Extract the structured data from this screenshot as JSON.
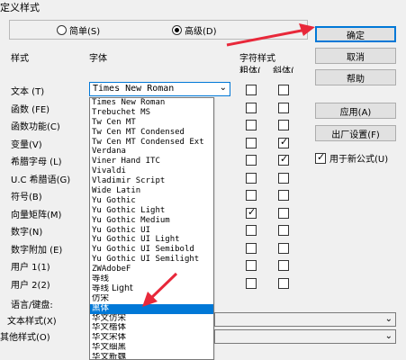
{
  "window": {
    "title": "定义样式"
  },
  "mode": {
    "simple_label": "简单(S)",
    "advanced_label": "高级(D)",
    "selected": "advanced"
  },
  "headers": {
    "style": "样式",
    "font": "字体",
    "char_style": "字符样式",
    "bold": "粗体(B)",
    "italic": "斜体(I)"
  },
  "rows": [
    {
      "label": "文本 (T)",
      "bold": false,
      "italic": false
    },
    {
      "label": "函数 (FE)",
      "bold": false,
      "italic": false
    },
    {
      "label": "函数功能(C)",
      "bold": false,
      "italic": false
    },
    {
      "label": "变量(V)",
      "bold": false,
      "italic": true
    },
    {
      "label": "希腊字母 (L)",
      "bold": false,
      "italic": true
    },
    {
      "label": "U.C 希腊语(G)",
      "bold": false,
      "italic": false
    },
    {
      "label": "符号(B)",
      "bold": false,
      "italic": false
    },
    {
      "label": "向量矩阵(M)",
      "bold": true,
      "italic": false
    },
    {
      "label": "数字(N)",
      "bold": false,
      "italic": false
    },
    {
      "label": "数字附加 (E)",
      "bold": false,
      "italic": false
    },
    {
      "label": "用户 1(1)",
      "bold": false,
      "italic": false
    },
    {
      "label": "用户 2(2)",
      "bold": false,
      "italic": false
    }
  ],
  "font_combo": {
    "value": "Times New Roman"
  },
  "font_list": [
    "Times New Roman",
    "Trebuchet MS",
    "Tw Cen MT",
    "Tw Cen MT Condensed",
    "Tw Cen MT Condensed Ext",
    "Verdana",
    "Viner Hand ITC",
    "Vivaldi",
    "Vladimir Script",
    "Wide Latin",
    "Yu Gothic",
    "Yu Gothic Light",
    "Yu Gothic Medium",
    "Yu Gothic UI",
    "Yu Gothic UI Light",
    "Yu Gothic UI Semibold",
    "Yu Gothic UI Semilight",
    "ZWAdobeF",
    "等线",
    "等线 Light",
    "仿宋",
    "黑体",
    "华文仿宋",
    "华文楷体",
    "华文宋体",
    "华文细黑",
    "华文新魏"
  ],
  "font_list_selected_index": 21,
  "buttons": {
    "ok": "确定",
    "cancel": "取消",
    "help": "帮助",
    "apply": "应用(A)",
    "factory": "出厂设置(F)"
  },
  "use_new_formula": {
    "label": "用于新公式(U)",
    "checked": true
  },
  "lower": {
    "language_label": "语言/键盘:",
    "text_style_label": "文本样式(X)",
    "other_style_label": "其他样式(O)"
  },
  "colors": {
    "accent": "#0078d7",
    "arrow": "#e8283a",
    "background": "#f0f0f0"
  }
}
